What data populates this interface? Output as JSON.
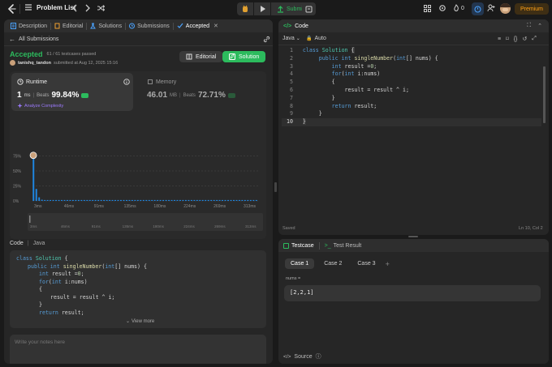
{
  "nav": {
    "title": "Problem List",
    "submit": "Submit",
    "premium": "Premium",
    "fire_count": "0"
  },
  "left_tabs": [
    {
      "label": "Description"
    },
    {
      "label": "Editorial"
    },
    {
      "label": "Solutions"
    },
    {
      "label": "Submissions"
    },
    {
      "label": "Accepted"
    }
  ],
  "submission": {
    "back_label": "All Submissions",
    "status": "Accepted",
    "testcases": "61 / 61 testcases passed",
    "user": "tanishq_tandon",
    "submitted": "submitted at Aug 12, 2025 15:16",
    "editorial_btn": "Editorial",
    "solution_btn": "Solution"
  },
  "runtime": {
    "title": "Runtime",
    "value": "1",
    "unit": "ms",
    "beats_label": "Beats",
    "beats": "99.84%",
    "analyze": "Analyze Complexity"
  },
  "memory": {
    "title": "Memory",
    "value": "46.01",
    "unit": "MB",
    "beats_label": "Beats",
    "beats": "72.71%"
  },
  "chart_data": {
    "type": "bar",
    "y_ticks": [
      "75%",
      "50%",
      "25%",
      "0%"
    ],
    "x_ticks": [
      "3ms",
      "46ms",
      "91ms",
      "135ms",
      "180ms",
      "224ms",
      "269ms",
      "313ms"
    ],
    "mini_ticks": [
      "3ms",
      "46ms",
      "91ms",
      "135ms",
      "180ms",
      "224ms",
      "269ms",
      "313ms"
    ],
    "values": [
      72,
      20,
      6,
      2,
      1.5,
      1.5,
      1.5,
      1.5,
      1.5,
      1.5,
      1.5,
      1.5,
      1.5,
      1.5,
      1.5,
      1.5,
      1.5,
      1.5,
      1.5,
      1.5,
      1.5,
      1.5,
      1.5,
      1.5,
      1.5,
      1.5,
      1.5,
      1.5,
      1.5,
      1.5,
      1.5,
      1.5,
      1.5,
      1.5,
      1.5,
      1.5,
      1.5,
      1.5,
      1.5,
      1.5,
      1.5,
      1.5,
      1.5,
      1.5,
      1.5,
      1.5,
      1.5,
      1.5,
      1.5,
      1.5,
      1.5,
      1.5,
      1.5,
      1.5,
      1.5,
      1.5,
      1.5,
      1.5,
      1.5,
      1.5,
      1.5,
      1.5,
      1.5,
      1.5,
      1.5,
      1.5,
      1.5,
      1.5,
      1.5,
      1.5,
      1.5,
      1.5,
      1.5,
      1.5,
      1.5,
      1.5,
      1.5,
      1.5,
      1.5,
      1.5
    ],
    "ylim": [
      0,
      100
    ],
    "highlight_index": 0,
    "bar_color": "#1e88e5"
  },
  "code_section": {
    "label": "Code",
    "lang": "Java",
    "view_more": "View more"
  },
  "notes": {
    "placeholder": "Write your notes here"
  },
  "editor": {
    "title": "Code",
    "lang": "Java",
    "auto": "Auto",
    "saved": "Saved",
    "position": "Ln 10, Col 2"
  },
  "test": {
    "tab1": "Testcase",
    "tab2": "Test Result",
    "cases": [
      "Case 1",
      "Case 2",
      "Case 3"
    ],
    "var_label": "nums =",
    "var_value": "[2,2,1]",
    "source": "Source"
  },
  "colors": {
    "accent_green": "#2cbb5d",
    "accepted": "#2cbb5d",
    "premium": "#ffa116",
    "blue": "#1e88e5"
  }
}
